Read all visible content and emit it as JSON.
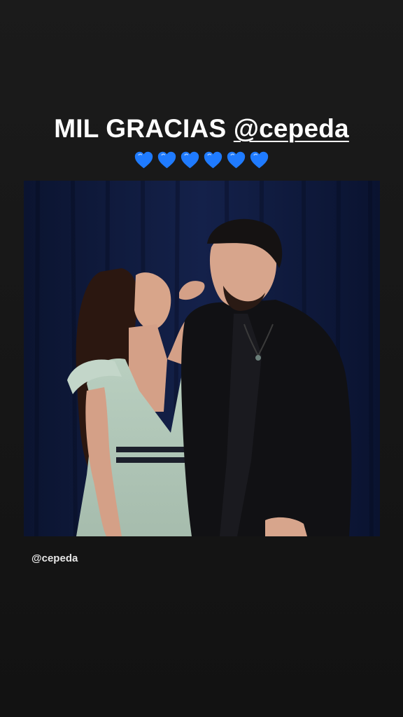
{
  "story": {
    "caption_prefix": "MIL GRACIAS ",
    "caption_mention": "@cepeda",
    "heart_count": 6,
    "heart_icon": "blue-heart-icon",
    "heart_color": "#1f7bff",
    "photo_tag": "@cepeda",
    "background_color": "#171717"
  }
}
